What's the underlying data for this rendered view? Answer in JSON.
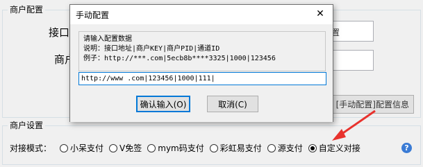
{
  "background": {
    "merchant_group_title": "商户配置",
    "label_interface": "接口",
    "label_merchant": "商户",
    "button_config_partial": "置",
    "button_manual_config": "[手动配置]配置信息",
    "settings_group_title": "商户设置",
    "dock_mode_label": "对接模式：",
    "radio_options": [
      {
        "label": "小呆支付",
        "checked": false
      },
      {
        "label": "V免签",
        "checked": false
      },
      {
        "label": "mym码支付",
        "checked": false
      },
      {
        "label": "彩虹易支付",
        "checked": false
      },
      {
        "label": "源支付",
        "checked": false
      },
      {
        "label": "自定义对接",
        "checked": true
      }
    ],
    "help_icon_glyph": "?"
  },
  "dialog": {
    "title": "手动配置",
    "close_glyph": "✕",
    "info_lines": [
      "请输入配置数据",
      "说明：接口地址|商户KEY|商户PID|通道ID",
      "例子：http://***.com|5ecb8b****3325|1000|123456"
    ],
    "input_value": "http://www     .com|123456|1000|111|",
    "ok_button": "确认输入(O)",
    "cancel_button": "取消(C)"
  },
  "colors": {
    "arrow": "#e8322d",
    "accent": "#0078d7"
  }
}
